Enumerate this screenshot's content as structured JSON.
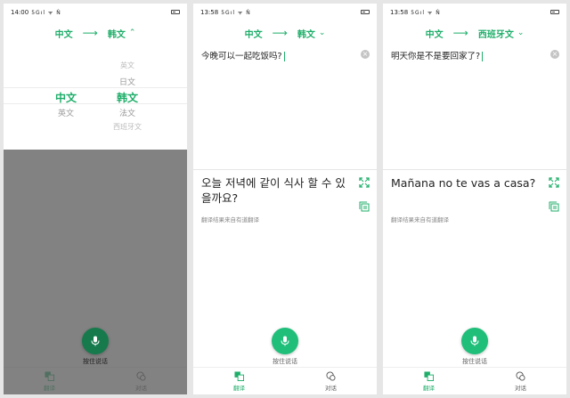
{
  "panels": [
    {
      "status": {
        "time": "14:00",
        "signal": "5Gıl ᯤ N̂"
      },
      "langbar": {
        "source": "中文",
        "arrow": "⟶",
        "target": "韩文",
        "chevron": "⌃"
      },
      "picker": {
        "left": {
          "selected": "中文",
          "below": "英文"
        },
        "right": {
          "above2": "英文",
          "above1": "日文",
          "selected": "韩文",
          "below1": "法文",
          "below2": "西班牙文"
        }
      },
      "hold_label": "按住说话",
      "tabs": [
        {
          "label": "翻译"
        },
        {
          "label": "对话"
        }
      ]
    },
    {
      "status": {
        "time": "13:58",
        "signal": "5Gıl ᯤ N̂"
      },
      "langbar": {
        "source": "中文",
        "arrow": "⟶",
        "target": "韩文",
        "chevron": "⌄"
      },
      "source_text": "今晚可以一起吃饭吗?",
      "result_text": "오늘 저녁에 같이 식사 할 수 있을까요?",
      "result_source": "翻译结果来自有道翻译",
      "hold_label": "按住说话",
      "tabs": [
        {
          "label": "翻译"
        },
        {
          "label": "对话"
        }
      ]
    },
    {
      "status": {
        "time": "13:58",
        "signal": "5Gıl ᯤ N̂"
      },
      "langbar": {
        "source": "中文",
        "arrow": "⟶",
        "target": "西班牙文",
        "chevron": "⌄"
      },
      "source_text": "明天你是不是要回家了?",
      "result_text": "Mañana no te vas a casa?",
      "result_source": "翻译结果来自有道翻译",
      "hold_label": "按住说话",
      "tabs": [
        {
          "label": "翻译"
        },
        {
          "label": "对话"
        }
      ]
    }
  ],
  "colors": {
    "accent": "#1fae6a",
    "mic": "#1fbf7a",
    "overlay": "#5f5f5f"
  },
  "icons": {
    "mic": "microphone-icon",
    "translate": "translate-icon",
    "dialog": "dialog-icon",
    "expand": "expand-icon",
    "copy": "copy-icon",
    "clear": "clear-icon"
  }
}
